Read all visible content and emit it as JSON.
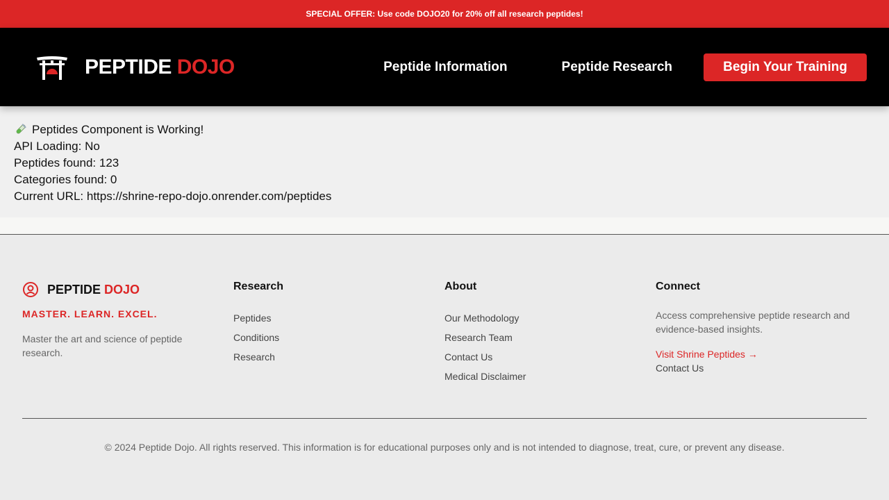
{
  "promo": {
    "text": "SPECIAL OFFER: Use code DOJO20 for 20% off all research peptides!"
  },
  "header": {
    "brand_primary": "PEPTIDE",
    "brand_accent": "DOJO",
    "logo_icon": "torii-gate-icon",
    "nav": {
      "info": "Peptide Information",
      "research": "Peptide Research"
    },
    "cta_label": "Begin Your Training"
  },
  "status": {
    "icon": "test-tube-icon",
    "heading": "Peptides Component is Working!",
    "api_loading": "API Loading: No",
    "peptides_found": "Peptides found: 123",
    "categories_found": "Categories found: 0",
    "current_url": "Current URL: https://shrine-repo-dojo.onrender.com/peptides"
  },
  "footer": {
    "brand_primary": "PEPTIDE",
    "brand_accent": "DOJO",
    "brand_icon": "user-circle-icon",
    "tagline": "MASTER. LEARN. EXCEL.",
    "description": "Master the art and science of peptide research.",
    "research": {
      "heading": "Research",
      "links": [
        "Peptides",
        "Conditions",
        "Research"
      ]
    },
    "about": {
      "heading": "About",
      "links": [
        "Our Methodology",
        "Research Team",
        "Contact Us",
        "Medical Disclaimer"
      ]
    },
    "connect": {
      "heading": "Connect",
      "text": "Access comprehensive peptide research and evidence-based insights.",
      "visit_link": "Visit Shrine Peptides →",
      "contact_link": "Contact Us"
    },
    "copyright": "© 2024 Peptide Dojo. All rights reserved. This information is for educational purposes only and is not intended to diagnose, treat, cure, or prevent any disease."
  },
  "colors": {
    "accent": "#dc2626",
    "nav_bg": "#000000",
    "page_bg": "#ebebeb"
  }
}
